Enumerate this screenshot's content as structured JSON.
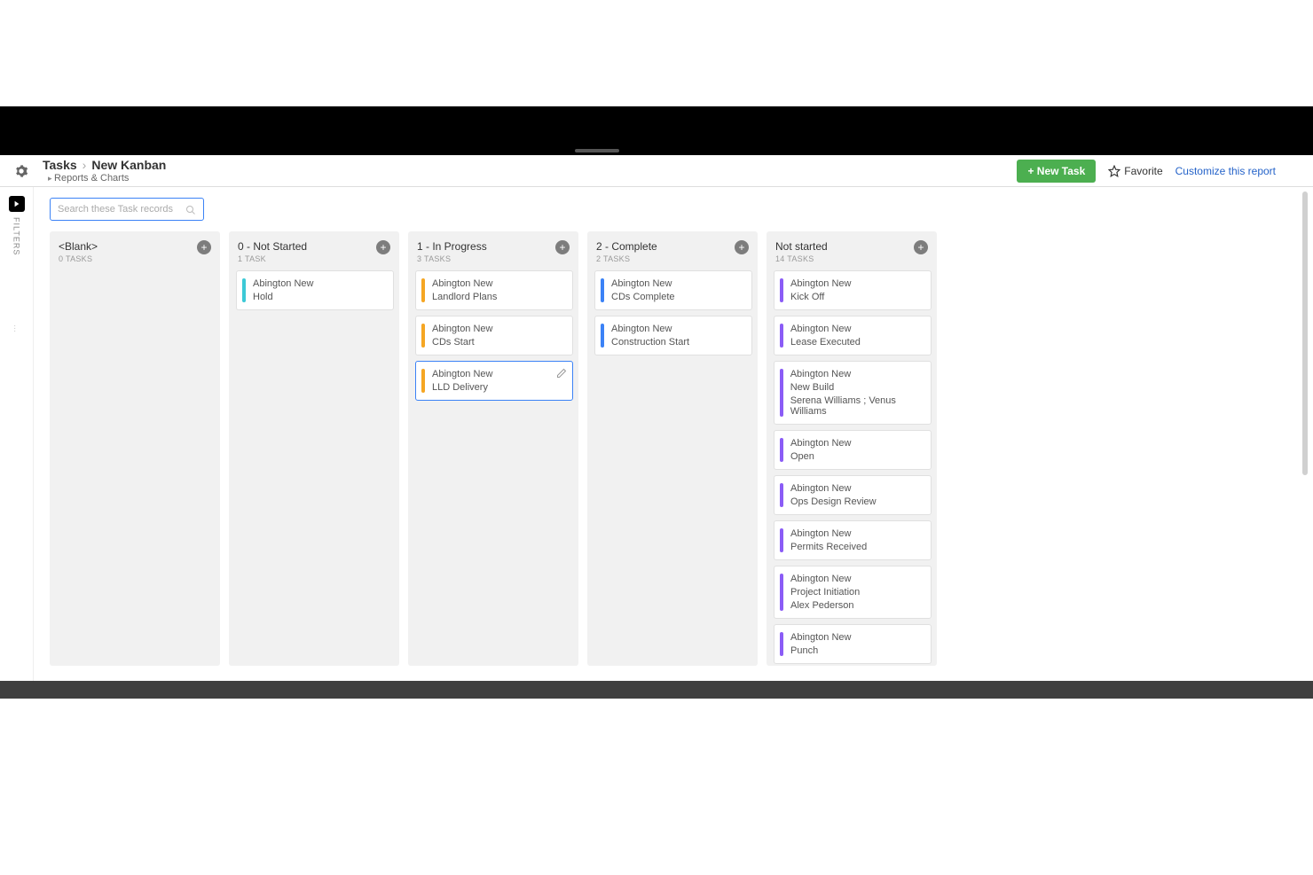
{
  "breadcrumb": {
    "root": "Tasks",
    "current": "New Kanban",
    "sub": "Reports & Charts"
  },
  "toolbar": {
    "new_task": "+ New Task",
    "favorite": "Favorite",
    "customize": "Customize this report"
  },
  "search": {
    "placeholder": "Search these Task records"
  },
  "filters_rail": {
    "label": "FILTERS"
  },
  "colors": {
    "teal": "#3cc9d6",
    "orange": "#f5a623",
    "blue": "#3b82f6",
    "purple": "#8b5cf6"
  },
  "columns": [
    {
      "title": "<Blank>",
      "sub": "0 TASKS",
      "cards": []
    },
    {
      "title": "0 - Not Started",
      "sub": "1 TASK",
      "cards": [
        {
          "stripe": "teal",
          "lines": [
            "Abington New",
            "Hold"
          ]
        }
      ]
    },
    {
      "title": "1 - In Progress",
      "sub": "3 TASKS",
      "cards": [
        {
          "stripe": "orange",
          "lines": [
            "Abington New",
            "Landlord Plans"
          ]
        },
        {
          "stripe": "orange",
          "lines": [
            "Abington New",
            "CDs Start"
          ]
        },
        {
          "stripe": "orange",
          "lines": [
            "Abington New",
            "LLD Delivery"
          ],
          "hovered": true,
          "edit": true
        }
      ]
    },
    {
      "title": "2 - Complete",
      "sub": "2 TASKS",
      "cards": [
        {
          "stripe": "blue",
          "lines": [
            "Abington New",
            "CDs Complete"
          ]
        },
        {
          "stripe": "blue",
          "lines": [
            "Abington New",
            "Construction Start"
          ]
        }
      ]
    },
    {
      "title": "Not started",
      "sub": "14 TASKS",
      "cards": [
        {
          "stripe": "purple",
          "lines": [
            "Abington New",
            "Kick Off"
          ]
        },
        {
          "stripe": "purple",
          "lines": [
            "Abington New",
            "Lease Executed"
          ]
        },
        {
          "stripe": "purple",
          "lines": [
            "Abington New",
            "New Build",
            "Serena Williams ; Venus Williams"
          ]
        },
        {
          "stripe": "purple",
          "lines": [
            "Abington New",
            "Open"
          ]
        },
        {
          "stripe": "purple",
          "lines": [
            "Abington New",
            "Ops Design Review"
          ]
        },
        {
          "stripe": "purple",
          "lines": [
            "Abington New",
            "Permits Received"
          ]
        },
        {
          "stripe": "purple",
          "lines": [
            "Abington New",
            "Project Initiation",
            "Alex Pederson"
          ]
        },
        {
          "stripe": "purple",
          "lines": [
            "Abington New",
            "Punch"
          ]
        }
      ]
    }
  ]
}
